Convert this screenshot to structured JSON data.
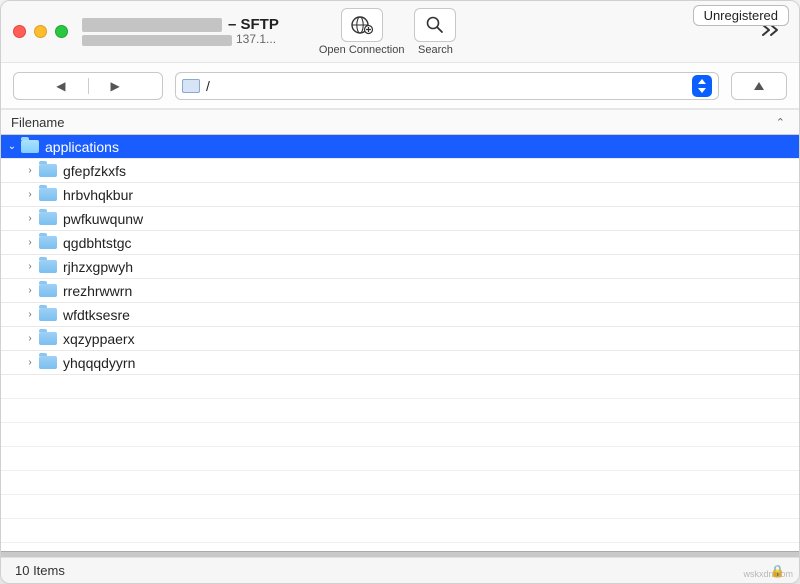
{
  "window": {
    "title_suffix": "– SFTP",
    "subtitle_suffix": "137.1...",
    "unregistered": "Unregistered"
  },
  "toolbar": {
    "open_connection": "Open Connection",
    "search": "Search"
  },
  "path": {
    "value": "/"
  },
  "columns": {
    "filename": "Filename"
  },
  "root": {
    "name": "applications"
  },
  "children": [
    {
      "name": "gfepfzkxfs"
    },
    {
      "name": "hrbvhqkbur"
    },
    {
      "name": "pwfkuwqunw"
    },
    {
      "name": "qgdbhtstgc"
    },
    {
      "name": "rjhzxgpwyh"
    },
    {
      "name": "rrezhrwwrn"
    },
    {
      "name": "wfdtksesre"
    },
    {
      "name": "xqzyppaerx"
    },
    {
      "name": "yhqqqdyyrn"
    }
  ],
  "status": {
    "count_label": "10 Items"
  },
  "watermark": "wskxdn.com"
}
